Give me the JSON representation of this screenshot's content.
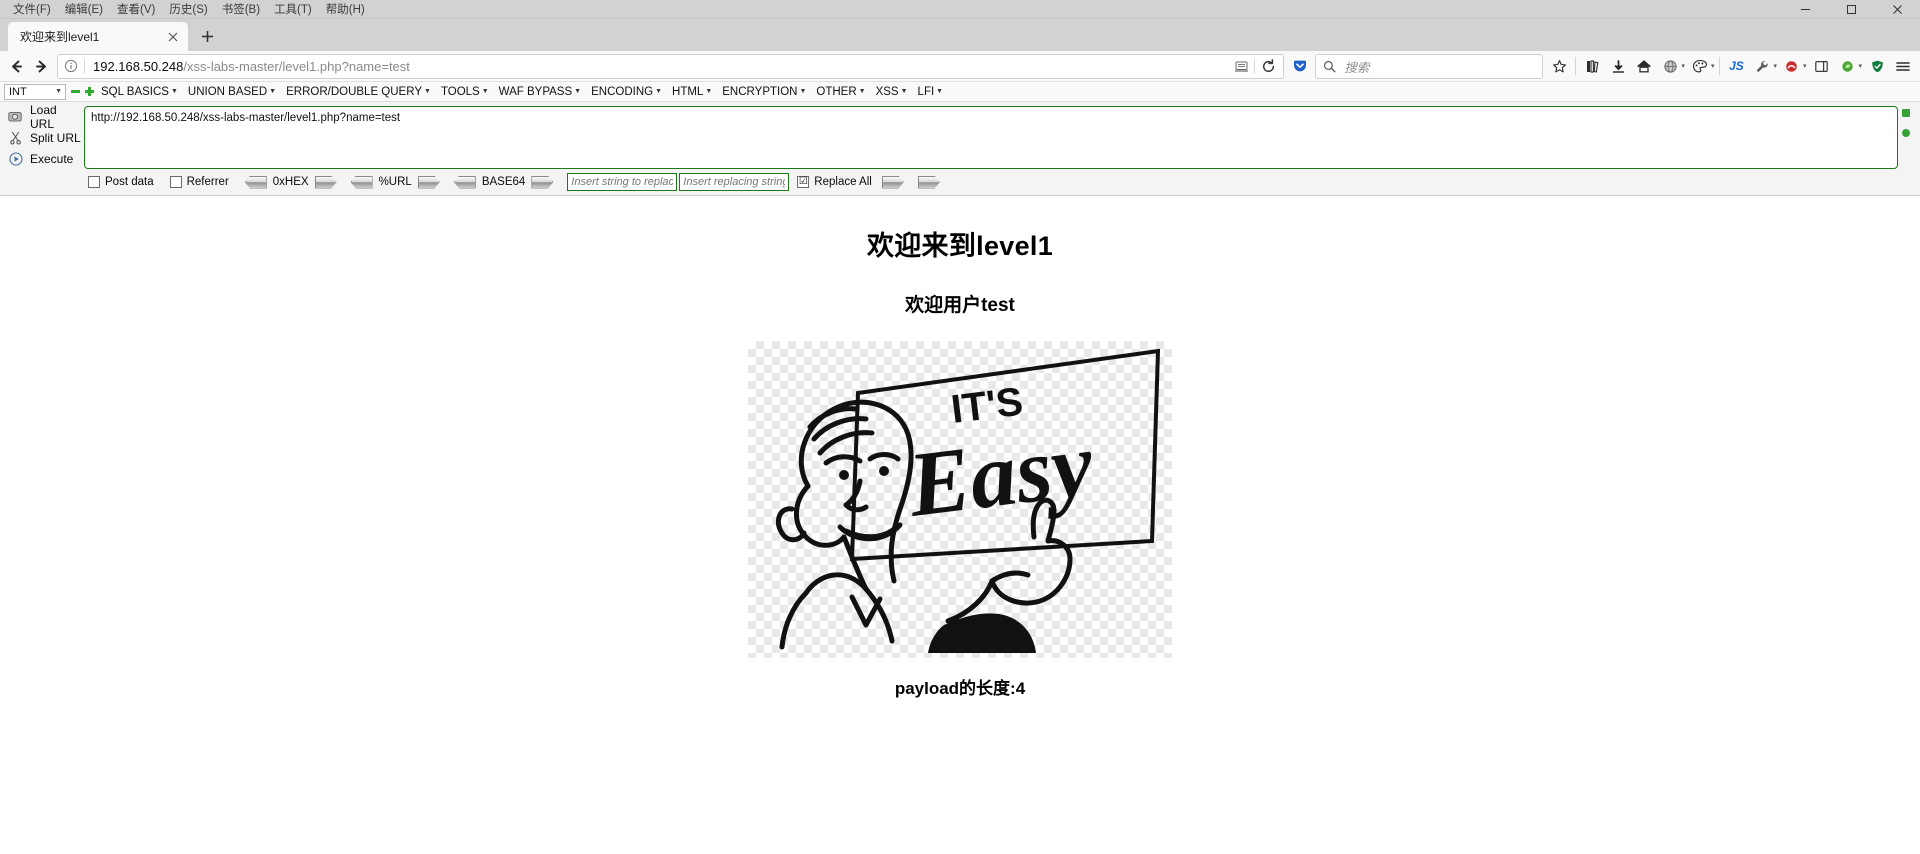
{
  "window": {
    "menus": [
      "文件(F)",
      "编辑(E)",
      "查看(V)",
      "历史(S)",
      "书签(B)",
      "工具(T)",
      "帮助(H)"
    ],
    "minimize": "─",
    "maximize": "☐",
    "close": "✕"
  },
  "tabs": {
    "items": [
      {
        "title": "欢迎来到level1",
        "close": "✕"
      }
    ],
    "new_tab": "+"
  },
  "nav": {
    "back": "←",
    "forward": "→",
    "reload": "⟳",
    "home": "⌂",
    "url_host": "192.168.50.248",
    "url_path": "/xss-labs-master/level1.php?name=test",
    "url_full": "192.168.50.248/xss-labs-master/level1.php?name=test",
    "identity_icon": "info-icon",
    "reader_icon": "reader-view-icon",
    "pocket_icon": "pocket-icon",
    "bookmark_star": "☆",
    "library_icon": "library-icon",
    "downloads_icon": "⬇",
    "sync_icon": "sync-icon",
    "menu_icon": "≡"
  },
  "search": {
    "placeholder": "搜索",
    "icon": "search-icon"
  },
  "extensions": [
    {
      "name": "js-extension",
      "label": "JS",
      "color": "#1a66d6"
    },
    {
      "name": "wrench-extension",
      "label": "",
      "color": "#555555"
    },
    {
      "name": "red-extension",
      "label": "",
      "color": "#cc2b2b"
    },
    {
      "name": "panel-extension",
      "label": "",
      "color": "#444444"
    },
    {
      "name": "green-extension",
      "label": "",
      "color": "#3a9b3a"
    },
    {
      "name": "shield-extension",
      "label": "",
      "color": "#0f7a3d"
    }
  ],
  "bookmarks": {
    "selector": "INT",
    "green_square": "▬",
    "green_plus": "✤",
    "items": [
      "SQL BASICS",
      "UNION BASED",
      "ERROR/DOUBLE QUERY",
      "TOOLS",
      "WAF BYPASS",
      "ENCODING",
      "HTML",
      "ENCRYPTION",
      "OTHER",
      "XSS",
      "LFI"
    ]
  },
  "hackbar": {
    "load_url": "Load URL",
    "split_url": "Split URL",
    "execute": "Execute",
    "url_value": "http://192.168.50.248/xss-labs-master/level1.php?name=test",
    "post_data": "Post data",
    "referrer": "Referrer",
    "hex_label": "0xHEX",
    "url_label": "%URL",
    "base64_label": "BASE64",
    "replace_from_placeholder": "Insert string to replace",
    "replace_to_placeholder": "Insert replacing string",
    "replace_all": "Replace All",
    "replace_all_checked": "☑",
    "unchecked": ""
  },
  "page": {
    "heading": "欢迎来到level1",
    "subheading": "欢迎用户test",
    "payload_length": "payload的长度:4",
    "image_alt": "IT'S Easy cartoon",
    "image_text_top": "IT'S",
    "image_text_main": "Easy"
  }
}
